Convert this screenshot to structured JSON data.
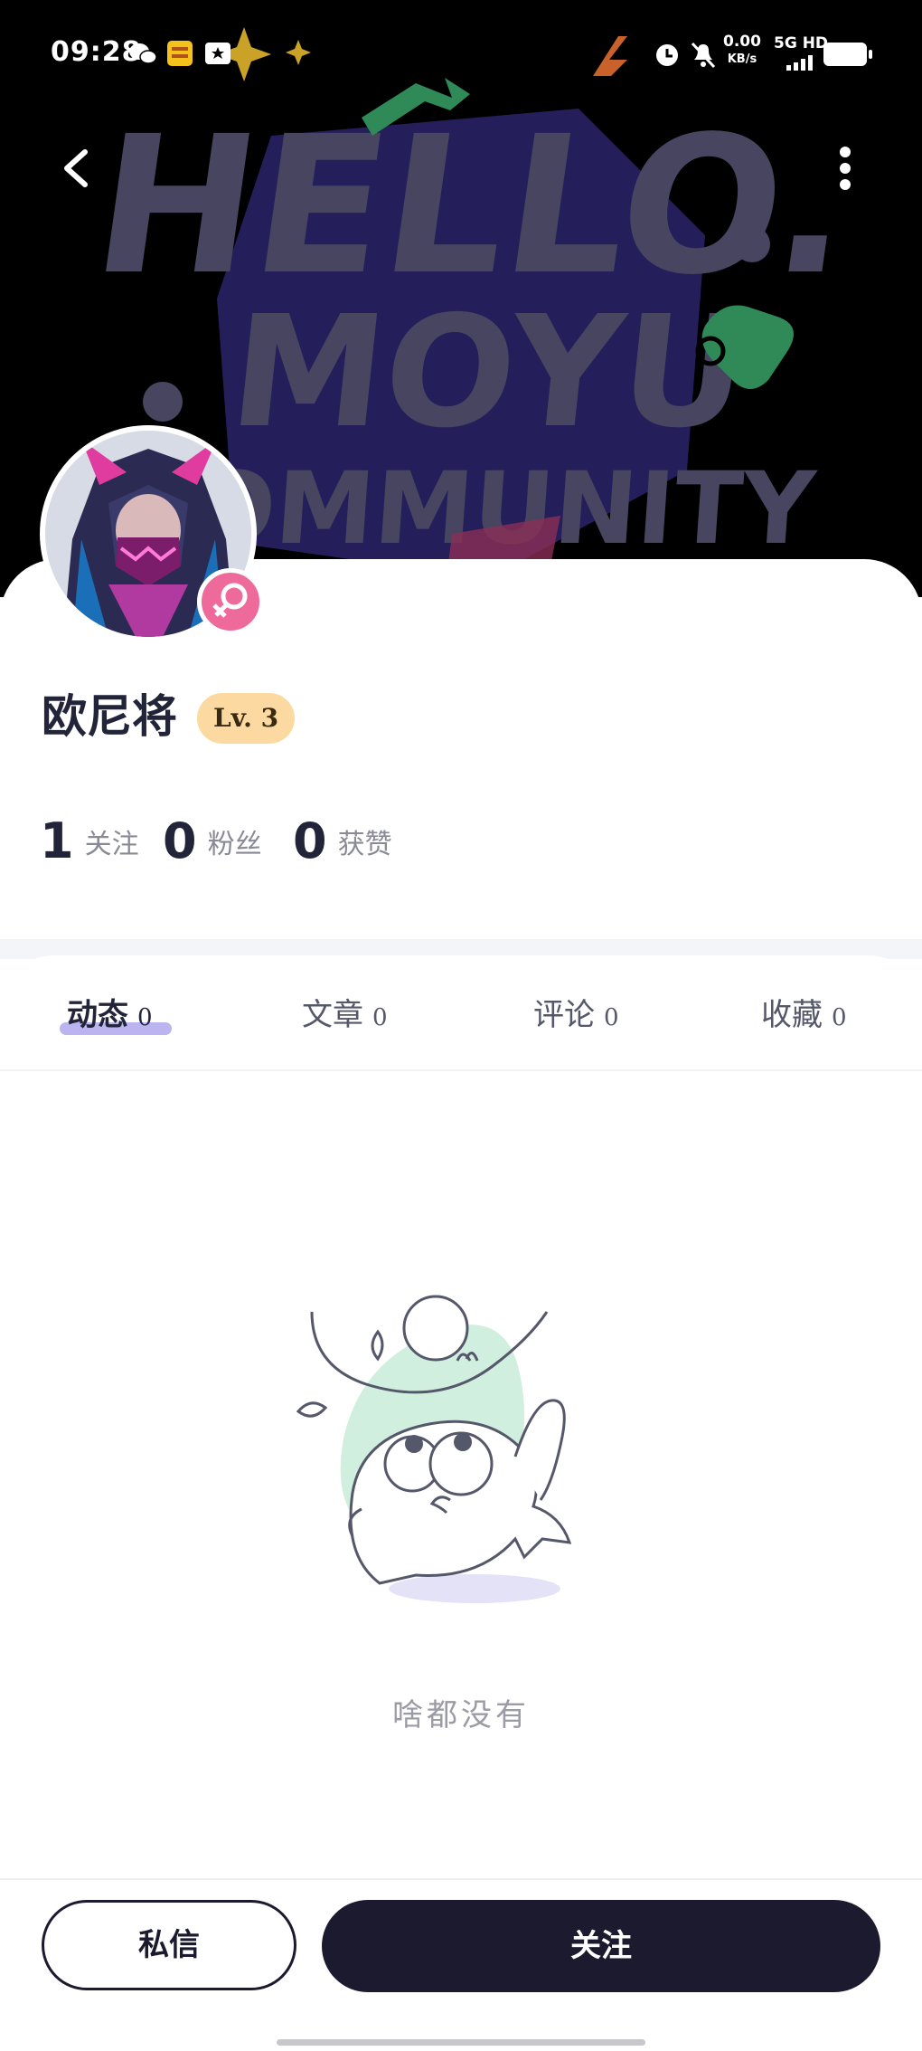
{
  "status_bar": {
    "time": "09:28",
    "net_speed_value": "0.00",
    "net_speed_unit": "KB/s",
    "network_label": "5G HD"
  },
  "banner": {
    "words": [
      "HELLO.",
      "MOYU",
      "COMMUNITY"
    ],
    "colors": {
      "text": "#474560",
      "blob": "#2a246a",
      "arrow": "#2f8a57",
      "controller": "#2f8a57",
      "bolt": "#c8622a",
      "star": "#c9a227"
    }
  },
  "profile": {
    "username": "欧尼将",
    "level": "Lv. 3",
    "gender": "female",
    "stats": [
      {
        "num": "1",
        "label": "关注"
      },
      {
        "num": "0",
        "label": "粉丝"
      },
      {
        "num": "0",
        "label": "获赞"
      }
    ]
  },
  "tabs": [
    {
      "label": "动态",
      "count": "0",
      "active": true
    },
    {
      "label": "文章",
      "count": "0",
      "active": false
    },
    {
      "label": "评论",
      "count": "0",
      "active": false
    },
    {
      "label": "收藏",
      "count": "0",
      "active": false
    }
  ],
  "empty_state": {
    "text": "啥都没有"
  },
  "actions": {
    "message": "私信",
    "follow": "关注"
  },
  "colors": {
    "primary": "#1b1a2e",
    "level_badge": "#fbd9a1",
    "gender_badge": "#ee6a9a",
    "tab_underline": "#a9a2ec"
  }
}
